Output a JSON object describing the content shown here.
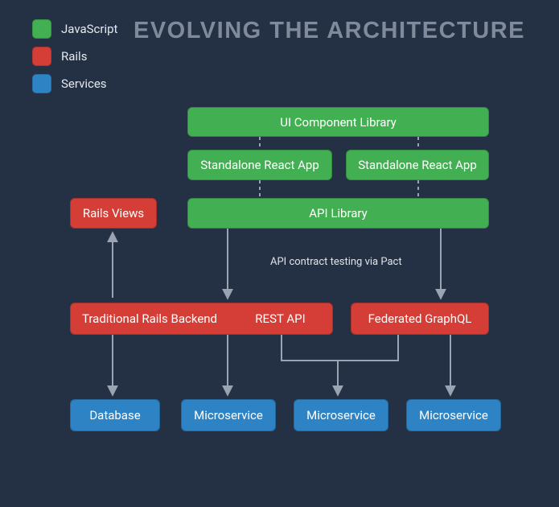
{
  "title": "EVOLVING THE ARCHITECTURE",
  "legend": {
    "javascript": "JavaScript",
    "rails": "Rails",
    "services": "Services"
  },
  "colors": {
    "javascript": "#42b052",
    "rails": "#d43e37",
    "services": "#2d83c4",
    "background": "#243044",
    "connector": "#9aa3b1",
    "title_text": "#7f8a9a"
  },
  "boxes": {
    "ui_component_library": "UI Component Library",
    "standalone_react_app_1": "Standalone React App",
    "standalone_react_app_2": "Standalone React App",
    "api_library": "API Library",
    "rails_views": "Rails Views",
    "traditional_rails_backend": "Traditional Rails Backend",
    "rest_api": "REST API",
    "federated_graphql": "Federated GraphQL",
    "database": "Database",
    "microservice_1": "Microservice",
    "microservice_2": "Microservice",
    "microservice_3": "Microservice"
  },
  "annotation": "API contract testing via Pact",
  "diagram_structure": {
    "tiers": [
      {
        "name": "ui",
        "nodes": [
          "ui_component_library"
        ]
      },
      {
        "name": "apps",
        "nodes": [
          "standalone_react_app_1",
          "standalone_react_app_2"
        ]
      },
      {
        "name": "api_lib",
        "nodes": [
          "api_library"
        ],
        "side_nodes": [
          "rails_views"
        ]
      },
      {
        "name": "backend",
        "nodes": [
          "traditional_rails_backend",
          "rest_api",
          "federated_graphql"
        ]
      },
      {
        "name": "data",
        "nodes": [
          "database",
          "microservice_1",
          "microservice_2",
          "microservice_3"
        ]
      }
    ],
    "edges": [
      {
        "from": "ui_component_library",
        "to": "standalone_react_app_1",
        "style": "dashed",
        "arrow": false
      },
      {
        "from": "ui_component_library",
        "to": "standalone_react_app_2",
        "style": "dashed",
        "arrow": false
      },
      {
        "from": "standalone_react_app_1",
        "to": "api_library",
        "style": "dashed",
        "arrow": false
      },
      {
        "from": "standalone_react_app_2",
        "to": "api_library",
        "style": "dashed",
        "arrow": false
      },
      {
        "from": "rails_views",
        "to": "traditional_rails_backend",
        "style": "solid",
        "arrow": true,
        "direction": "up"
      },
      {
        "from": "api_library",
        "to": "rest_api",
        "style": "solid",
        "arrow": true,
        "label": "API contract testing via Pact"
      },
      {
        "from": "api_library",
        "to": "federated_graphql",
        "style": "solid",
        "arrow": true
      },
      {
        "from": "traditional_rails_backend",
        "to": "database",
        "style": "solid",
        "arrow": true
      },
      {
        "from": "rest_api",
        "to": "microservice_1",
        "style": "solid",
        "arrow": true
      },
      {
        "from": "rest_api",
        "to": "microservice_2",
        "style": "solid",
        "arrow": true,
        "via": "bracket"
      },
      {
        "from": "federated_graphql",
        "to": "microservice_2",
        "style": "solid",
        "arrow": true,
        "via": "bracket_left"
      },
      {
        "from": "federated_graphql",
        "to": "microservice_3",
        "style": "solid",
        "arrow": true
      }
    ]
  }
}
